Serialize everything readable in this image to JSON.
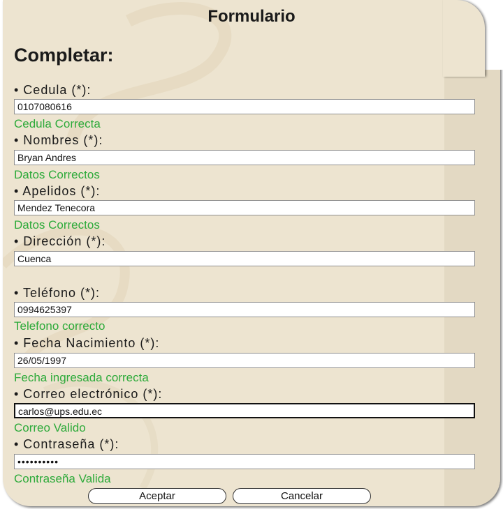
{
  "title": "Formulario",
  "subtitle": "Completar:",
  "fields": {
    "cedula": {
      "label": "• Cedula (*):",
      "value": "0107080616",
      "msg": "Cedula Correcta"
    },
    "nombres": {
      "label": "• Nombres (*):",
      "value": "Bryan Andres",
      "msg": "Datos Correctos"
    },
    "apellidos": {
      "label": "• Apelidos (*):",
      "value": "Mendez Tenecora",
      "msg": "Datos Correctos"
    },
    "direccion": {
      "label": "• Dirección (*):",
      "value": "Cuenca",
      "msg": ""
    },
    "telefono": {
      "label": "• Teléfono (*):",
      "value": "0994625397",
      "msg": "Telefono correcto"
    },
    "fecha": {
      "label": "• Fecha Nacimiento (*):",
      "value": "26/05/1997",
      "msg": "Fecha ingresada correcta"
    },
    "correo": {
      "label": "• Correo electrónico (*):",
      "value": "carlos@ups.edu.ec",
      "msg": "Correo Valido"
    },
    "contrasena": {
      "label": "• Contraseña (*):",
      "value": "••••••••••",
      "msg": "Contraseña Valida"
    }
  },
  "buttons": {
    "accept": "Aceptar",
    "cancel": "Cancelar"
  },
  "colors": {
    "panel_bg": "#ede4d0",
    "success": "#2daa3a"
  }
}
